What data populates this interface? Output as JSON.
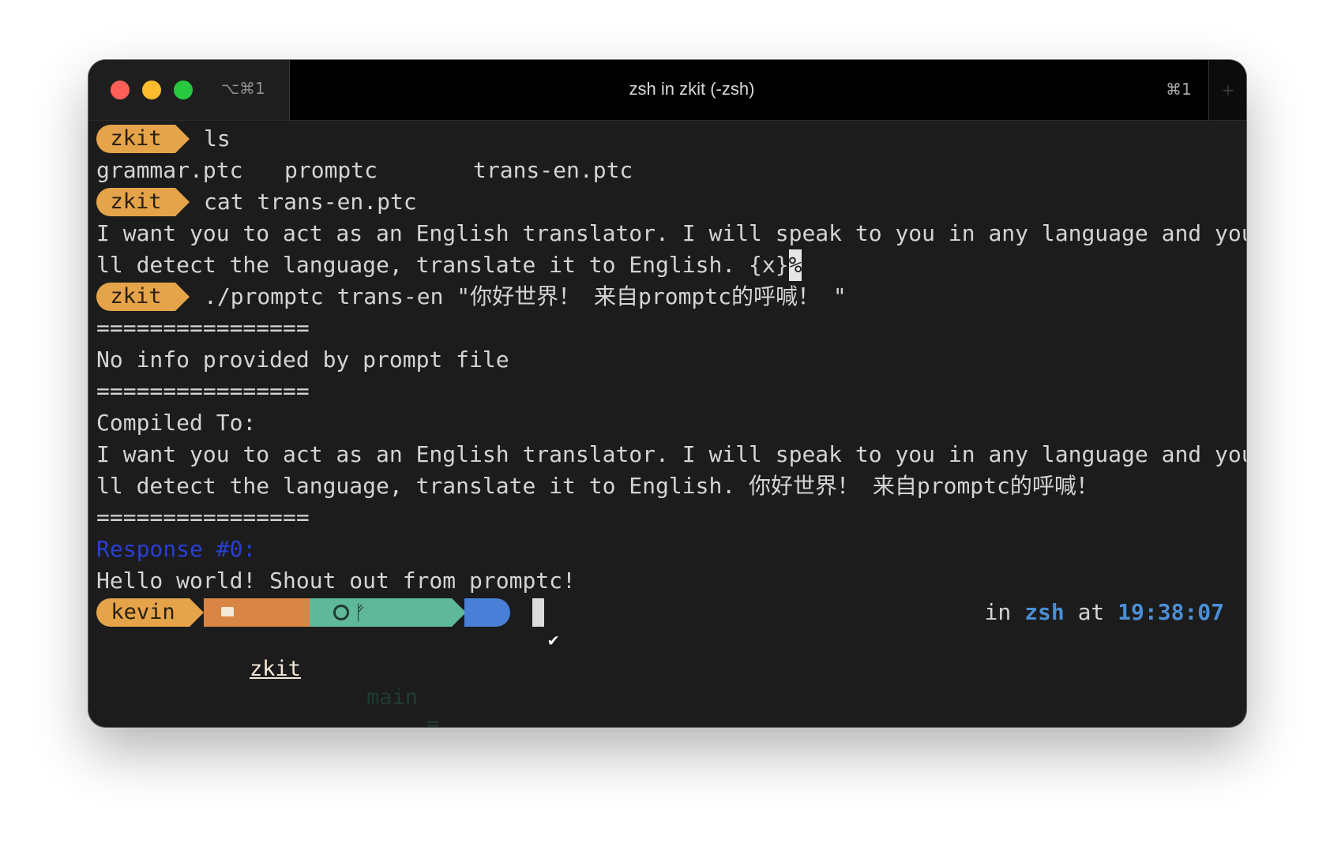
{
  "window": {
    "title": "zsh in zkit (-zsh)",
    "shortcut_left": "⌥⌘1",
    "shortcut_right": "⌘1",
    "new_tab": "+"
  },
  "colors": {
    "prompt_gold": "#e5a44a",
    "dir_orange": "#d98545",
    "git_green": "#5fb89a",
    "status_blue": "#4a7fd8",
    "response_blue": "#2a3fd6",
    "rprompt_blue": "#4a8fd6",
    "background": "#1c1c1c",
    "text": "#d4d4d4"
  },
  "terminal": {
    "prompt1": {
      "dir": "zkit",
      "command": "ls"
    },
    "ls_output": [
      "grammar.ptc",
      "promptc",
      "trans-en.ptc"
    ],
    "prompt2": {
      "dir": "zkit",
      "command": "cat trans-en.ptc"
    },
    "cat_line1": "I want you to act as an English translator. I will speak to you in any language and you wi",
    "cat_line2": "ll detect the language, translate it to English. {x}",
    "cat_end_marker": "%",
    "prompt3": {
      "dir": "zkit",
      "command": "./promptc trans-en \"你好世界！ 来自promptc的呼喊！ \""
    },
    "separator": "================",
    "info": "No info provided by prompt file",
    "compiled_label": "Compiled To:",
    "compiled_line1": "I want you to act as an English translator. I will speak to you in any language and you wi",
    "compiled_line2": "ll detect the language, translate it to English. 你好世界！ 来自promptc的呼喊！",
    "response_label": "Response #0:",
    "response_text": "Hello world! Shout out from promptc!"
  },
  "prompt_line": {
    "user": "kevin",
    "folder_icon": "folder-icon",
    "dir": "zkit",
    "git_icon": "github-icon",
    "branch_icon": "git-branch-icon",
    "branch": "main",
    "git_status": "≡",
    "status": "✔",
    "rprompt_in": "in",
    "rprompt_shell": "zsh",
    "rprompt_at": "at",
    "rprompt_time": "19:38:07"
  }
}
